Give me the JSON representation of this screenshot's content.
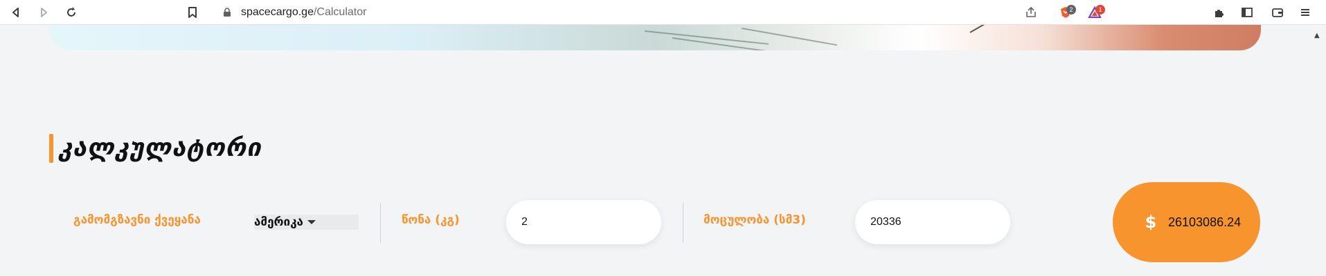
{
  "browser": {
    "url_host": "spacecargo.ge",
    "url_path": "/Calculator",
    "brave_badge": "2",
    "rewards_badge": "1",
    "icons": [
      "back-icon",
      "forward-icon",
      "reload-icon",
      "bookmark-icon",
      "lock-icon",
      "share-icon",
      "brave-shields-icon",
      "brave-rewards-icon",
      "extensions-icon",
      "sidebar-icon",
      "wallet-icon",
      "menu-icon"
    ]
  },
  "page": {
    "heading": "კალკულატორი",
    "calculator": {
      "country_label": "გამომგზავნი ქვეყანა",
      "country_value": "ამერიკა",
      "weight_label": "წონა (კგ)",
      "weight_value": "2",
      "volume_label": "მოცულობა (სმ3)",
      "volume_value": "20336",
      "currency_symbol": "$",
      "total_value": "26103086.24"
    },
    "accent_color": "#f7942e"
  }
}
